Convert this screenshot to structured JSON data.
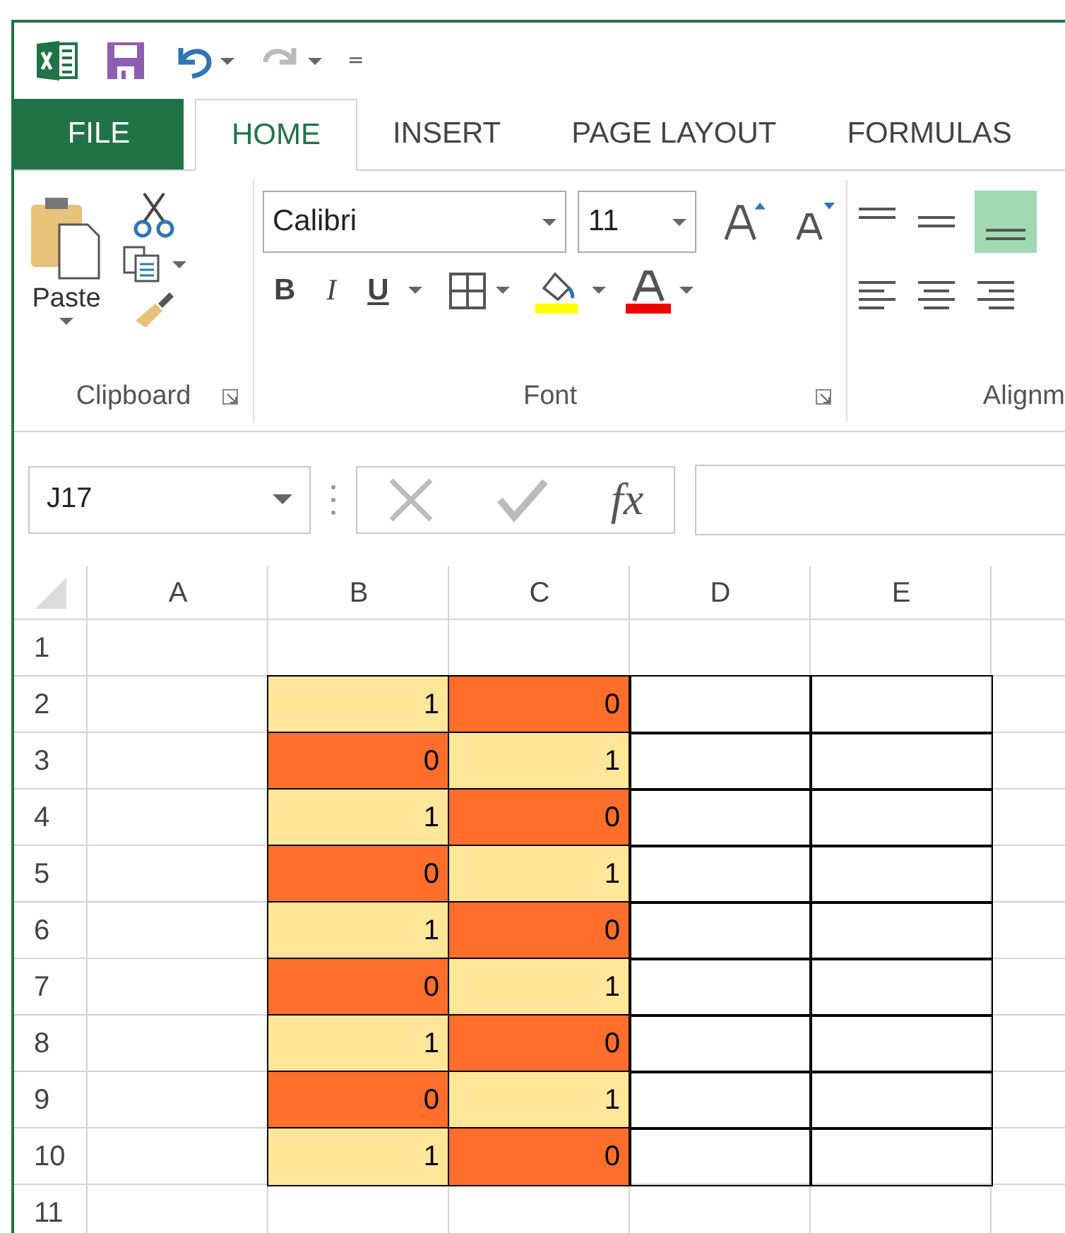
{
  "quick_access": {
    "customize": "="
  },
  "tabs": [
    {
      "label": "FILE",
      "kind": "file",
      "selected": false
    },
    {
      "label": "HOME",
      "kind": "tab",
      "selected": true
    },
    {
      "label": "INSERT",
      "kind": "tab",
      "selected": false
    },
    {
      "label": "PAGE LAYOUT",
      "kind": "tab",
      "selected": false
    },
    {
      "label": "FORMULAS",
      "kind": "tab",
      "selected": false
    }
  ],
  "ribbon": {
    "clipboard": {
      "paste": "Paste",
      "label": "Clipboard"
    },
    "font": {
      "name": "Calibri",
      "size": "11",
      "bold": "B",
      "italic": "I",
      "underline": "U",
      "label": "Font"
    },
    "alignment": {
      "label": "Alignm"
    }
  },
  "formula_bar": {
    "name_box": "J17",
    "fx": "fx"
  },
  "sheet": {
    "columns": [
      "A",
      "B",
      "C",
      "D",
      "E"
    ],
    "rows": [
      {
        "header": "1",
        "cells": []
      },
      {
        "header": "2",
        "cells": [
          {
            "value": "1",
            "color": "#ffe699"
          },
          {
            "value": "0",
            "color": "#ff6e2a"
          }
        ]
      },
      {
        "header": "3",
        "cells": [
          {
            "value": "0",
            "color": "#ff6e2a"
          },
          {
            "value": "1",
            "color": "#ffe699"
          }
        ]
      },
      {
        "header": "4",
        "cells": [
          {
            "value": "1",
            "color": "#ffe699"
          },
          {
            "value": "0",
            "color": "#ff6e2a"
          }
        ]
      },
      {
        "header": "5",
        "cells": [
          {
            "value": "0",
            "color": "#ff6e2a"
          },
          {
            "value": "1",
            "color": "#ffe699"
          }
        ]
      },
      {
        "header": "6",
        "cells": [
          {
            "value": "1",
            "color": "#ffe699"
          },
          {
            "value": "0",
            "color": "#ff6e2a"
          }
        ]
      },
      {
        "header": "7",
        "cells": [
          {
            "value": "0",
            "color": "#ff6e2a"
          },
          {
            "value": "1",
            "color": "#ffe699"
          }
        ]
      },
      {
        "header": "8",
        "cells": [
          {
            "value": "1",
            "color": "#ffe699"
          },
          {
            "value": "0",
            "color": "#ff6e2a"
          }
        ]
      },
      {
        "header": "9",
        "cells": [
          {
            "value": "0",
            "color": "#ff6e2a"
          },
          {
            "value": "1",
            "color": "#ffe699"
          }
        ]
      },
      {
        "header": "10",
        "cells": [
          {
            "value": "1",
            "color": "#ffe699"
          },
          {
            "value": "0",
            "color": "#ff6e2a"
          }
        ]
      },
      {
        "header": "11",
        "cells": []
      }
    ]
  }
}
